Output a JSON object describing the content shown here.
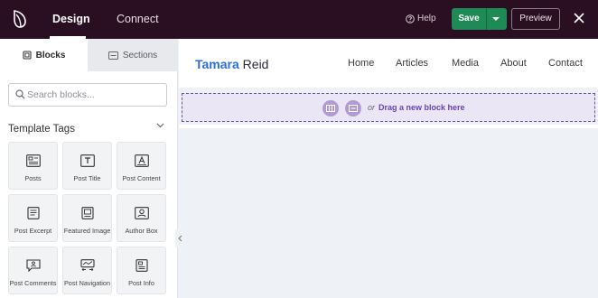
{
  "topbar": {
    "logo_icon": "sprout-logo-icon",
    "tabs": [
      {
        "label": "Design",
        "active": true
      },
      {
        "label": "Connect",
        "active": false
      }
    ],
    "help_label": "Help",
    "save_label": "Save",
    "preview_label": "Preview",
    "close_icon": "close-icon",
    "colors": {
      "bar": "#2a0f22",
      "save": "#1e8a56"
    }
  },
  "sidebar": {
    "tabs": [
      {
        "label": "Blocks",
        "icon": "blocks-icon",
        "active": true
      },
      {
        "label": "Sections",
        "icon": "sections-icon",
        "active": false
      }
    ],
    "search": {
      "placeholder": "Search blocks...",
      "value": ""
    },
    "template_tags": {
      "title": "Template Tags",
      "blocks": [
        {
          "label": "Posts",
          "icon": "posts-icon"
        },
        {
          "label": "Post Title",
          "icon": "post-title-icon"
        },
        {
          "label": "Post Content",
          "icon": "post-content-icon"
        },
        {
          "label": "Post Excerpt",
          "icon": "post-excerpt-icon"
        },
        {
          "label": "Featured Image",
          "icon": "featured-image-icon"
        },
        {
          "label": "Author Box",
          "icon": "author-box-icon"
        },
        {
          "label": "Post Comments",
          "icon": "post-comments-icon"
        },
        {
          "label": "Post Navigation",
          "icon": "post-navigation-icon"
        },
        {
          "label": "Post Info",
          "icon": "post-info-icon"
        }
      ]
    }
  },
  "preview": {
    "site_title_first": "Tamara",
    "site_title_last": "Reid",
    "nav": [
      "Home",
      "Articles",
      "Media",
      "About",
      "Contact"
    ],
    "dropzone": {
      "or_text": "or",
      "drag_text": "Drag a new block here",
      "accent": "#6a3fb3"
    }
  }
}
